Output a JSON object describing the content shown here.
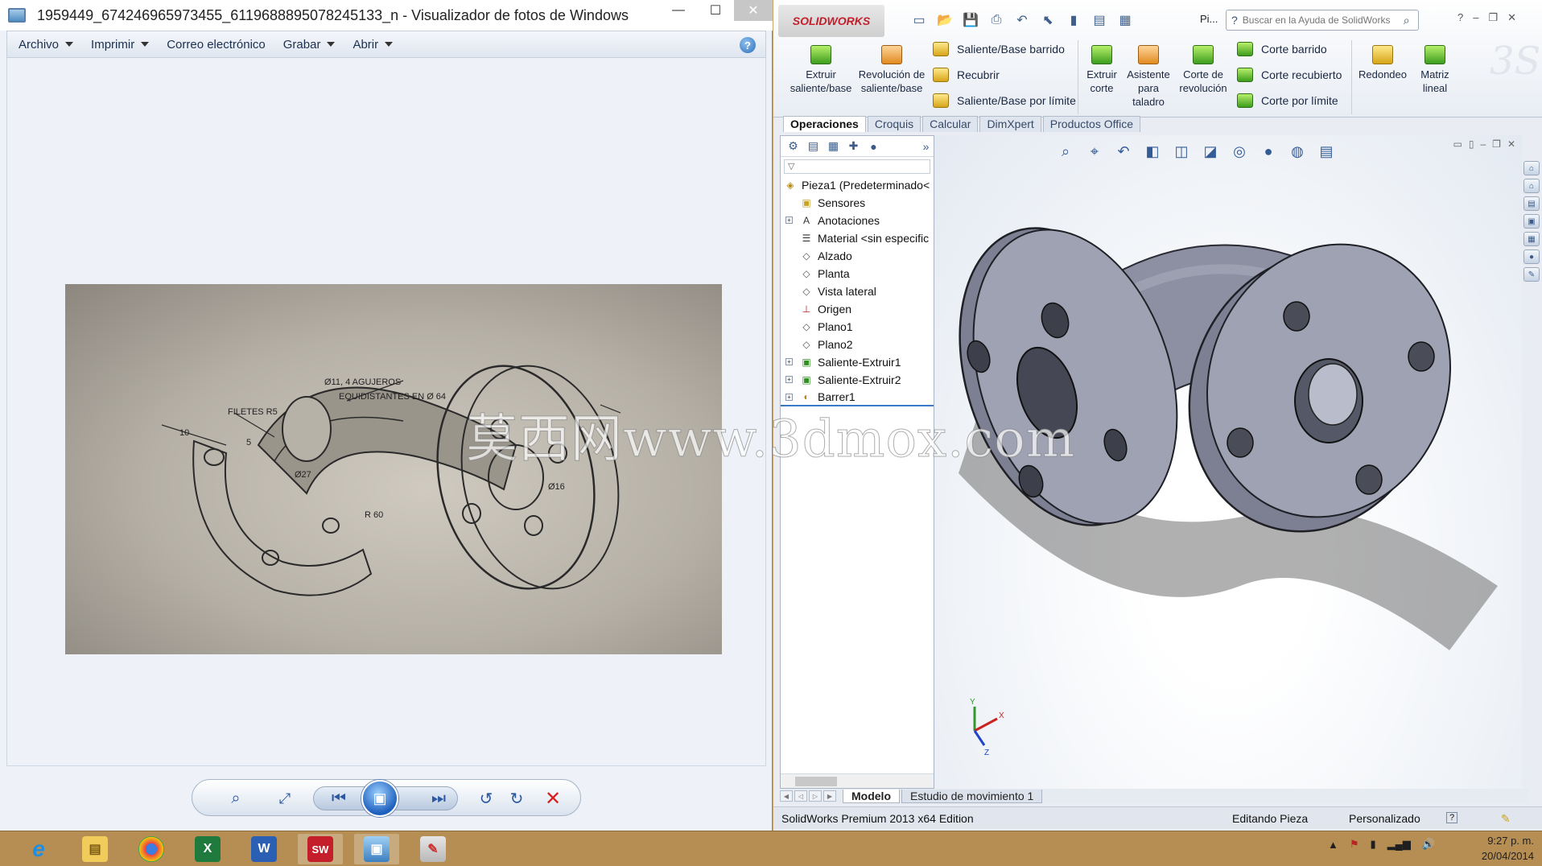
{
  "photo_viewer": {
    "title": "1959449_674246965973455_6119688895078245133_n - Visualizador de fotos de Windows",
    "caption_min": "—",
    "caption_max": "☐",
    "caption_close": "✕",
    "menu": [
      "Archivo",
      "Imprimir",
      "Correo electrónico",
      "Grabar",
      "Abrir"
    ],
    "help": "?",
    "photo": {
      "label_holes": "Ø11, 4 AGUJEROS",
      "label_equi": "EQUIDISTANTES EN Ø 64",
      "label_fillets": "FILETES R5",
      "label_10": "10",
      "label_5": "5",
      "label_27": "Ø27",
      "label_r60": "R 60",
      "label_16": "Ø16",
      "watermark": "莫西网www.3dmox.com"
    },
    "toolbar": {
      "zoom": "⌕",
      "fit": "⤢",
      "prev": "⏮",
      "slideshow": "▣",
      "next": "⏭",
      "rotate_left": "↺",
      "rotate_right": "↻",
      "delete": "✕"
    }
  },
  "solidworks": {
    "logo": "SOLIDWORKS",
    "pi_label": "Pi...",
    "search_placeholder": "Buscar en la Ayuda de SolidWorks",
    "commands": {
      "extrude_boss": "Extruir saliente/base",
      "revolve_boss": "Revolución de saliente/base",
      "swept_boss": "Saliente/Base barrido",
      "loft": "Recubrir",
      "boundary_boss": "Saliente/Base por límite",
      "extrude_cut": "Extruir corte",
      "hole_wizard": "Asistente para taladro",
      "revolve_cut": "Corte de revolución",
      "swept_cut": "Corte barrido",
      "lofted_cut": "Corte recubierto",
      "boundary_cut": "Corte por límite",
      "fillet": "Redondeo",
      "linear_pattern": "Matriz lineal"
    },
    "tabs": [
      "Operaciones",
      "Croquis",
      "Calcular",
      "DimXpert",
      "Productos Office"
    ],
    "tree": {
      "root": "Pieza1  (Predeterminado<",
      "items": [
        "Sensores",
        "Anotaciones",
        "Material <sin especific",
        "Alzado",
        "Planta",
        "Vista lateral",
        "Origen",
        "Plano1",
        "Plano2",
        "Saliente-Extruir1",
        "Saliente-Extruir2",
        "Barrer1"
      ]
    },
    "bottom_tabs": [
      "Modelo",
      "Estudio de movimiento 1"
    ],
    "status": {
      "edition": "SolidWorks Premium 2013 x64 Edition",
      "mode": "Editando Pieza",
      "units": "Personalizado",
      "help": "?"
    },
    "triad": {
      "x": "X",
      "y": "Y",
      "z": "Z"
    }
  },
  "taskbar": {
    "apps": [
      "Internet Explorer",
      "Explorador de archivos",
      "Google Chrome",
      "Excel",
      "Word",
      "SolidWorks",
      "Visualizador de fotos",
      "Paint"
    ],
    "app_glyphs": [
      "e",
      "▤",
      "◉",
      "X",
      "W",
      "SW",
      "▣",
      "✎"
    ],
    "time": "9:27 p. m.",
    "date": "20/04/2014"
  },
  "colors": {
    "taskbar": "#b68e54",
    "sw_red": "#c41e2a",
    "model_gray": "#8f94a6"
  }
}
